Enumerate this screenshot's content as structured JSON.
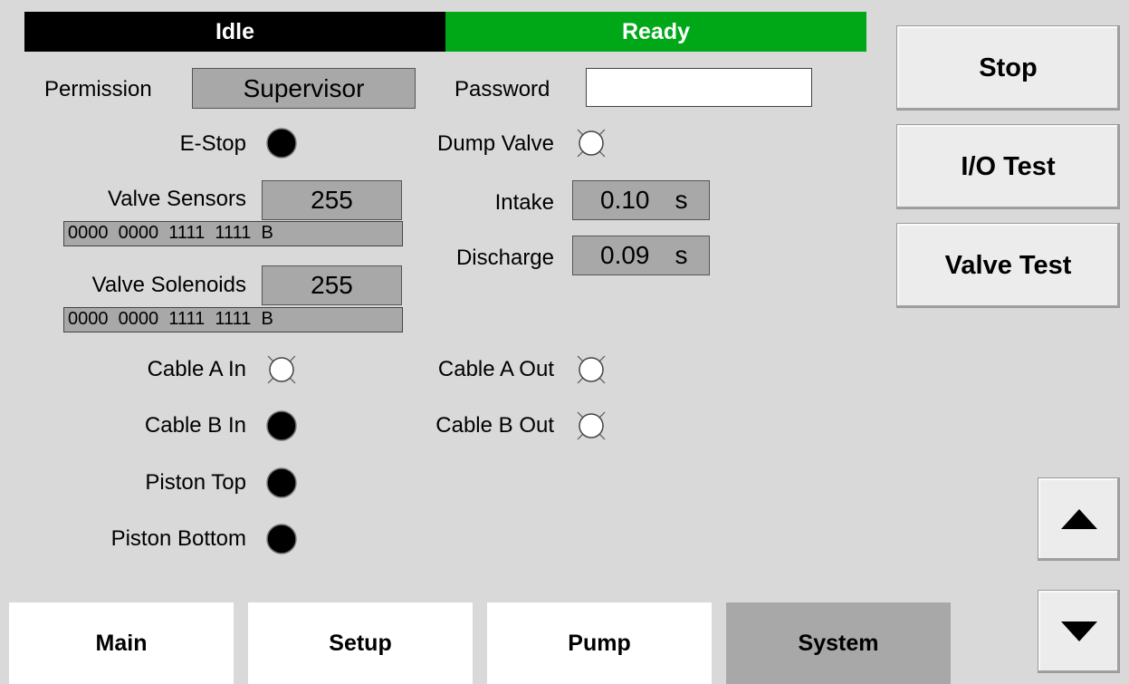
{
  "status": {
    "left": "Idle",
    "right": "Ready",
    "ready_color": "#00a818"
  },
  "permission": {
    "label": "Permission",
    "value": "Supervisor"
  },
  "password": {
    "label": "Password",
    "value": ""
  },
  "indicators": {
    "estop": {
      "label": "E-Stop",
      "state": "on"
    },
    "dump_valve": {
      "label": "Dump Valve",
      "state": "off"
    },
    "cable_a_in": {
      "label": "Cable A In",
      "state": "off"
    },
    "cable_a_out": {
      "label": "Cable A Out",
      "state": "off"
    },
    "cable_b_in": {
      "label": "Cable B In",
      "state": "on"
    },
    "cable_b_out": {
      "label": "Cable B Out",
      "state": "off"
    },
    "piston_top": {
      "label": "Piston Top",
      "state": "on"
    },
    "piston_bottom": {
      "label": "Piston Bottom",
      "state": "on"
    }
  },
  "valve_sensors": {
    "label": "Valve Sensors",
    "value": "255",
    "bits": "0000  0000  1111  1111  B"
  },
  "valve_solenoids": {
    "label": "Valve Solenoids",
    "value": "255",
    "bits": "0000  0000  1111  1111  B"
  },
  "intake": {
    "label": "Intake",
    "value": "0.10",
    "unit": "s"
  },
  "discharge": {
    "label": "Discharge",
    "value": "0.09",
    "unit": "s"
  },
  "side_buttons": {
    "stop": "Stop",
    "io_test": "I/O Test",
    "valve_test": "Valve Test"
  },
  "scroll": {
    "up_icon": "triangle-up-icon",
    "down_icon": "triangle-down-icon"
  },
  "tabs": [
    {
      "label": "Main",
      "selected": false
    },
    {
      "label": "Setup",
      "selected": false
    },
    {
      "label": "Pump",
      "selected": false
    },
    {
      "label": "System",
      "selected": true
    }
  ]
}
